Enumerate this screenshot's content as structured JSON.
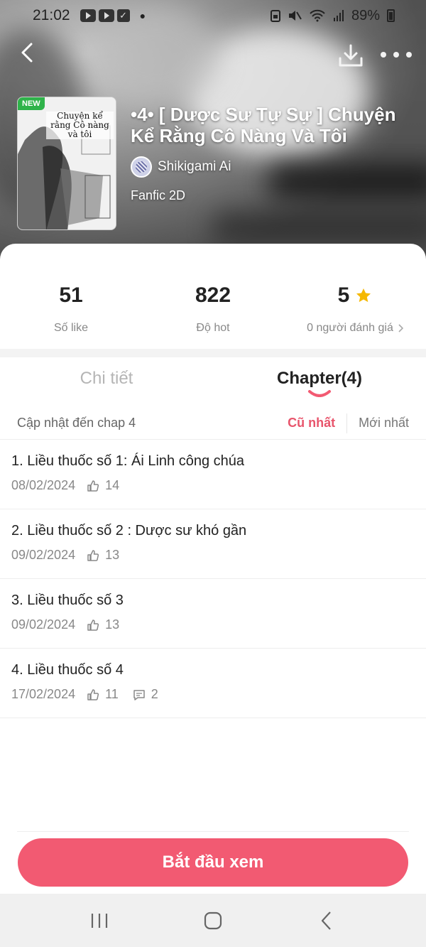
{
  "status_bar": {
    "time": "21:02",
    "battery": "89%"
  },
  "header": {
    "cover_badge": "NEW",
    "cover_title": "Chuyện kể rằng Cô nàng và tôi",
    "title_line1": "•4• [ Dược Sư Tự Sự ] Chuyện",
    "title_line2": "Kể Rằng Cô Nàng Và Tôi",
    "author": "Shikigami Ai",
    "genre": "Fanfic 2D"
  },
  "stats": [
    {
      "value": "51",
      "label": "Số like"
    },
    {
      "value": "822",
      "label": "Độ hot"
    },
    {
      "value": "5",
      "label": "0 người đánh giá"
    }
  ],
  "tabs": [
    {
      "label": "Chi tiết",
      "active": false
    },
    {
      "label": "Chapter(4)",
      "active": true
    }
  ],
  "filter": {
    "update_text": "Cập nhật đến chap 4",
    "sort_oldest": "Cũ nhất",
    "sort_newest": "Mới nhất"
  },
  "chapters": [
    {
      "title": "1. Liều thuốc số 1: Ái Linh công chúa",
      "date": "08/02/2024",
      "likes": "14"
    },
    {
      "title": "2. Liều thuốc số 2 : Dược sư khó gần",
      "date": "09/02/2024",
      "likes": "13"
    },
    {
      "title": "3. Liều thuốc số 3",
      "date": "09/02/2024",
      "likes": "13"
    },
    {
      "title": "4. Liều thuốc số 4",
      "date": "17/02/2024",
      "likes": "11",
      "comments": "2"
    }
  ],
  "start_button": "Bắt đầu xem",
  "colors": {
    "accent": "#f25a72",
    "accent_text": "#e8556c",
    "star": "#f5b800",
    "badge": "#2fb34a"
  },
  "icons": [
    "back-arrow-icon",
    "download-icon",
    "more-dots-icon",
    "star-icon",
    "thumb-up-icon",
    "comment-icon",
    "chevron-right-icon"
  ]
}
